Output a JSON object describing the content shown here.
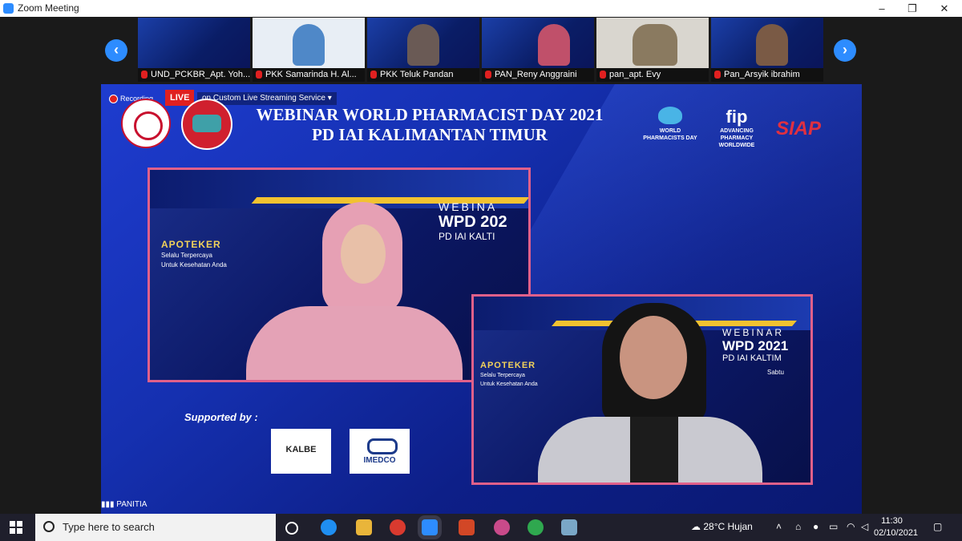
{
  "window": {
    "title": "Zoom Meeting",
    "minimize": "–",
    "maximize": "❐",
    "close": "✕"
  },
  "gallery": {
    "prev_arrow": "‹",
    "next_arrow": "›",
    "participants": [
      {
        "name": "UND_PCKBR_Apt. Yoh..."
      },
      {
        "name": "PKK Samarinda H. Al..."
      },
      {
        "name": "PKK Teluk Pandan"
      },
      {
        "name": "PAN_Reny Anggraini"
      },
      {
        "name": "pan_apt. Evy"
      },
      {
        "name": "Pan_Arsyik ibrahim"
      }
    ]
  },
  "main": {
    "recording_label": "Recording",
    "live_badge": "LIVE",
    "stream_label": "on Custom Live Streaming Service",
    "stream_caret": "▾",
    "title_line1": "WEBINAR WORLD PHARMACIST DAY 2021",
    "title_line2": "PD IAI KALIMANTAN TIMUR",
    "org1_line1": "WORLD",
    "org1_line2": "PHARMACISTS DAY",
    "org2_name": "fip",
    "org2_line1": "ADVANCING",
    "org2_line2": "PHARMACY",
    "org2_line3": "WORLDWIDE",
    "org3_name": "SIAP",
    "supported_by": "Supported by :",
    "sponsor1": "KALBE",
    "sponsor2": "IMEDCO",
    "panel_label": "PANITIA"
  },
  "video1": {
    "apoteker": "APOTEKER",
    "tag1": "Selalu Terpercaya",
    "tag2": "Untuk Kesehatan Anda",
    "webinar": "WEBINA",
    "wpd": "WPD 202",
    "pd": "PD IAI KALTI"
  },
  "video2": {
    "apoteker": "APOTEKER",
    "tag1": "Selalu Terpercaya",
    "tag2": "Untuk Kesehatan Anda",
    "webinar": "WEBINAR",
    "wpd": "WPD 2021",
    "pd": "PD IAI KALTIM",
    "day": "Sabtu"
  },
  "taskbar": {
    "search_placeholder": "Type here to search",
    "weather": "28°C  Hujan",
    "time": "11:30",
    "date": "02/10/2021"
  },
  "colors": {
    "accent": "#2d8cff",
    "live_red": "#e02020",
    "frame_pink": "#e0608a",
    "stage_bg": "#1a1a1a"
  }
}
